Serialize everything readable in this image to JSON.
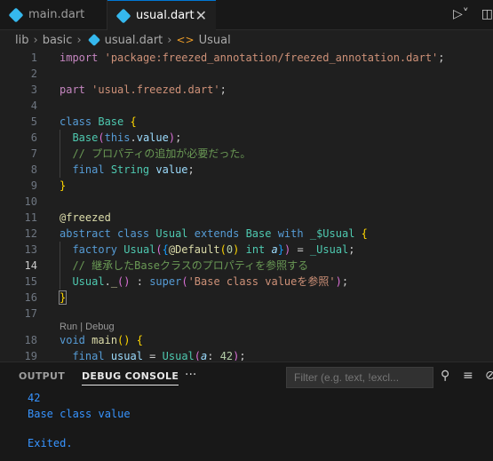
{
  "tabs": [
    {
      "label": "main.dart"
    },
    {
      "label": "usual.dart",
      "close": "✕"
    }
  ],
  "breadcrumb": [
    "lib",
    "basic",
    "usual.dart",
    "Usual"
  ],
  "editor": {
    "line_numbers": [
      "1",
      "2",
      "3",
      "4",
      "5",
      "6",
      "7",
      "8",
      "9",
      "10",
      "11",
      "12",
      "13",
      "14",
      "15",
      "16",
      "17",
      "18",
      "19"
    ],
    "codelens": "Run | Debug"
  },
  "panel": {
    "tabs": [
      "OUTPUT",
      "DEBUG CONSOLE"
    ],
    "more": "···",
    "filter_placeholder": "Filter (e.g. text, !excl...",
    "output_lines": [
      "42",
      "Base class value",
      "",
      "Exited."
    ]
  }
}
